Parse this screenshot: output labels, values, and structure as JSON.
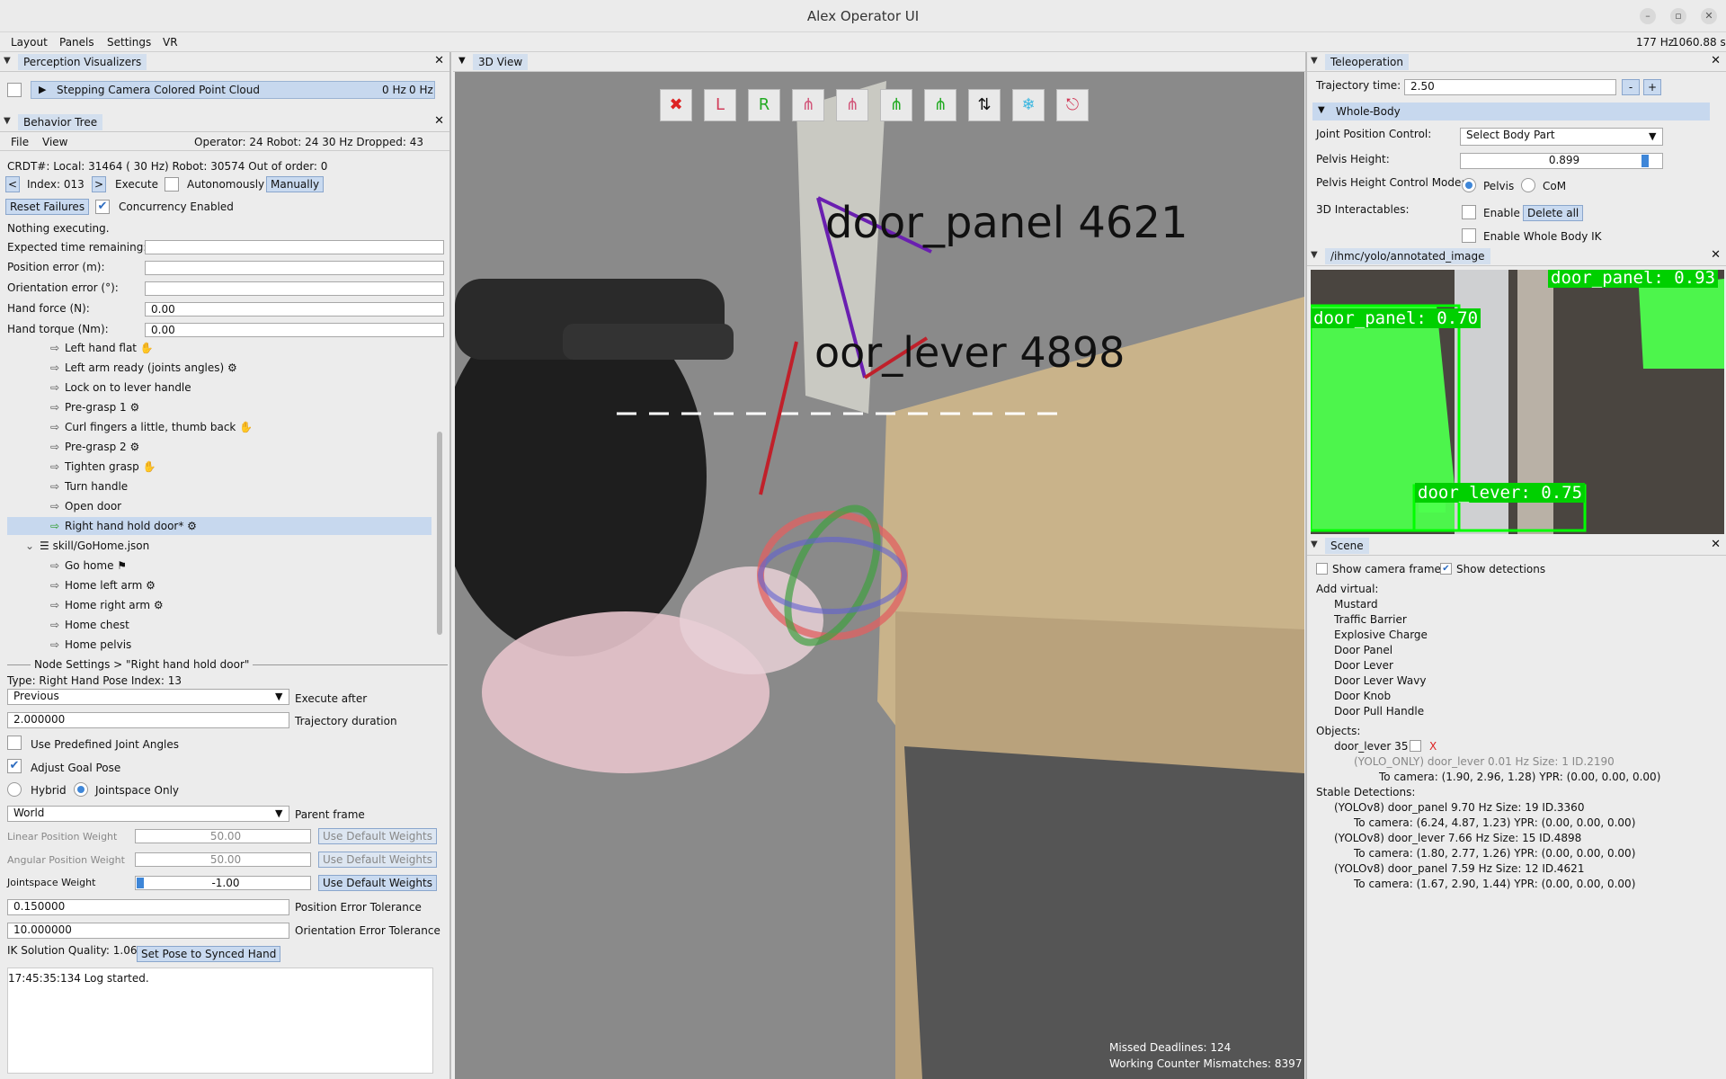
{
  "app": {
    "title": "Alex Operator UI",
    "status_rate": "177 Hz",
    "status_value": "1060.88 s"
  },
  "menu": [
    "Layout",
    "Panels",
    "Settings",
    "VR"
  ],
  "perception": {
    "title": "Perception Visualizers",
    "item": "Stepping Camera Colored Point Cloud",
    "rate1": "0 Hz",
    "rate2": "0 Hz"
  },
  "bt": {
    "title": "Behavior Tree",
    "file": "File",
    "view": "View",
    "stats": "Operator:  24  Robot:  24   30 Hz  Dropped:   43",
    "crdt": "CRDT#: Local: 31464 ( 30 Hz)  Robot: 30574  Out of order: 0",
    "prev": "<",
    "index": "Index: 013",
    "next": ">",
    "execute": "Execute",
    "autonomously": "Autonomously",
    "manually": "Manually",
    "reset": "Reset Failures",
    "concurrency": "Concurrency Enabled",
    "nothing": "Nothing executing.",
    "labels": [
      "Expected time remaining:",
      "Position error (m):",
      "Orientation error (°):",
      "Hand force (N):",
      "Hand torque (Nm):"
    ],
    "hand_force": "0.00",
    "hand_torque": "0.00",
    "nodes": [
      "Left hand flat",
      "Left arm ready (joints angles)",
      "Lock on to lever handle",
      "Pre-grasp 1",
      "Curl fingers a little, thumb back",
      "Pre-grasp 2",
      "Tighten grasp",
      "Turn handle",
      "Open door",
      "Right hand hold door*"
    ],
    "skill": "skill/GoHome.json",
    "skill_nodes": [
      "Go home",
      "Home left arm",
      "Home right arm",
      "Home chest",
      "Home pelvis"
    ]
  },
  "node": {
    "header": "Node Settings > \"Right hand hold door\"",
    "type": "Type: Right Hand Pose   Index: 13",
    "exec_select": "Previous",
    "exec_label": "Execute after",
    "duration": "2.000000",
    "duration_label": "Trajectory duration",
    "predef": "Use Predefined Joint Angles",
    "adjust": "Adjust Goal Pose",
    "hybrid": "Hybrid",
    "jointspace": "Jointspace Only",
    "frame": "World",
    "frame_label": "Parent frame",
    "lin_label": "Linear Position Weight",
    "lin_val": "50.00",
    "ang_label": "Angular Position Weight",
    "ang_val": "50.00",
    "js_label": "Jointspace Weight",
    "js_val": "-1.00",
    "default_btn": "Use Default Weights",
    "pos_tol": "0.150000",
    "pos_tol_label": "Position Error Tolerance",
    "ori_tol": "10.000000",
    "ori_tol_label": "Orientation Error Tolerance",
    "ik": "IK Solution Quality: 1.06",
    "set_pose": "Set Pose to Synced Hand",
    "log": "17:45:35:134 Log started."
  },
  "view3d": {
    "title": "3D View",
    "label1": "door_panel 4621",
    "label2": "oor_lever 4898",
    "missed": "Missed Deadlines: 124",
    "mismatch": "Working Counter Mismatches: 8397"
  },
  "teleop": {
    "title": "Teleoperation",
    "traj_label": "Trajectory time:",
    "traj": "2.50",
    "minus": "-",
    "plus": "+",
    "section": "Whole-Body",
    "jpc_label": "Joint Position Control:",
    "jpc": "Select Body Part",
    "pelvis_label": "Pelvis Height:",
    "pelvis": "0.899",
    "mode_label": "Pelvis Height Control Mode:",
    "pelvis_opt": "Pelvis",
    "com_opt": "CoM",
    "inter_label": "3D Interactables:",
    "enable": "Enable",
    "delete_all": "Delete all",
    "wbik": "Enable Whole Body IK"
  },
  "yolo": {
    "title": "/ihmc/yolo/annotated_image",
    "d1": "door_panel: 0.93",
    "d2": "door_panel: 0.70",
    "d3": "door_lever: 0.75"
  },
  "scene": {
    "title": "Scene",
    "show_cam": "Show camera frame",
    "show_det": "Show detections",
    "add_virtual": "Add virtual:",
    "virtual": [
      "Mustard",
      "Traffic Barrier",
      "Explosive Charge",
      "Door Panel",
      "Door Lever",
      "Door Lever Wavy",
      "Door Knob",
      "Door Pull Handle"
    ],
    "objects": "Objects:",
    "obj1": "door_lever 35",
    "obj1_x": "X",
    "obj1_detail": "(YOLO_ONLY) door_lever 0.01 Hz Size: 1 ID.2190",
    "obj1_cam": "To camera: (1.90, 2.96, 1.28) YPR: (0.00, 0.00, 0.00)",
    "stable": "Stable Detections:",
    "dets": [
      {
        "t": "(YOLOv8) door_panel 9.70 Hz Size: 19 ID.3360",
        "c": "To camera: (6.24, 4.87, 1.23) YPR: (0.00, 0.00, 0.00)"
      },
      {
        "t": "(YOLOv8) door_lever 7.66 Hz Size: 15 ID.4898",
        "c": "To camera: (1.80, 2.77, 1.26) YPR: (0.00, 0.00, 0.00)"
      },
      {
        "t": "(YOLOv8) door_panel 7.59 Hz Size: 12 ID.4621",
        "c": "To camera: (1.67, 2.90, 1.44) YPR: (0.00, 0.00, 0.00)"
      }
    ]
  }
}
